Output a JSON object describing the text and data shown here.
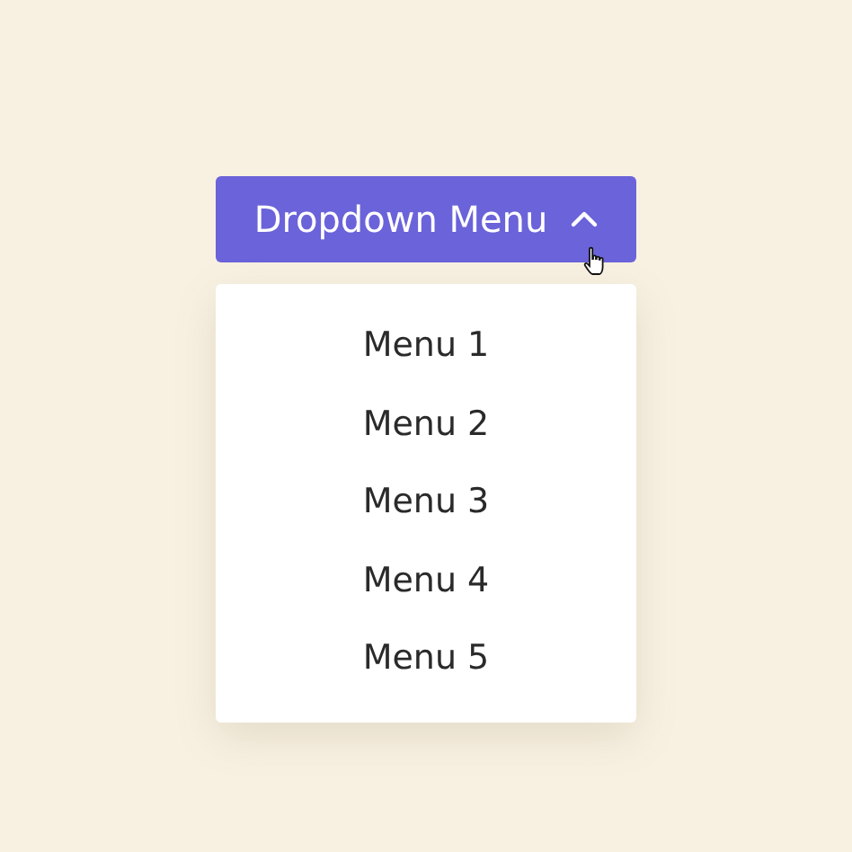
{
  "dropdown": {
    "label": "Dropdown Menu",
    "expanded": true,
    "items": [
      {
        "label": "Menu 1"
      },
      {
        "label": "Menu 2"
      },
      {
        "label": "Menu 3"
      },
      {
        "label": "Menu 4"
      },
      {
        "label": "Menu 5"
      }
    ]
  }
}
